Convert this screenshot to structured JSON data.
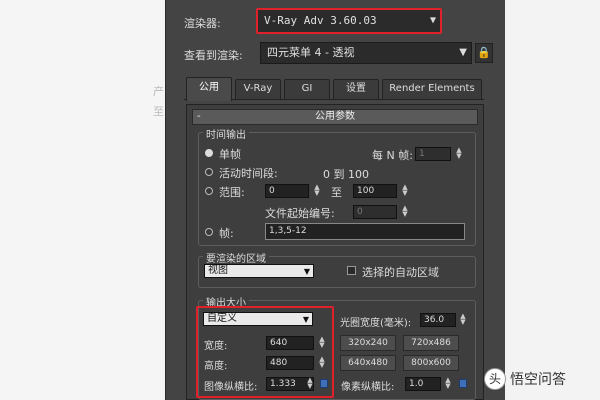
{
  "background": {
    "left_glyphs": [
      "产",
      "至"
    ]
  },
  "renderer": {
    "label": "渲染器:",
    "value": "V-Ray Adv 3.60.03"
  },
  "view": {
    "label": "查看到渲染:",
    "value": "四元菜单 4 - 透视"
  },
  "tabs": [
    "公用",
    "V-Ray",
    "GI",
    "设置",
    "Render Elements"
  ],
  "rollout_title": "公用参数",
  "time_output": {
    "title": "时间输出",
    "single": "单帧",
    "every_n_label": "每 N 帧:",
    "every_n_value": "1",
    "active_segment": "活动时间段:",
    "active_range": "0 到 100",
    "range_label": "范围:",
    "range_from": "0",
    "range_to_label": "至",
    "range_to": "100",
    "file_start_label": "文件起始编号:",
    "file_start_value": "0",
    "frames_label": "帧:",
    "frames_value": "1,3,5-12"
  },
  "area": {
    "title": "要渲染的区域",
    "value": "视图",
    "auto_region_label": "选择的自动区域"
  },
  "output_size": {
    "title": "输出大小",
    "preset": "自定义",
    "aperture_label": "光圈宽度(毫米):",
    "aperture_value": "36.0",
    "width_label": "宽度:",
    "width_value": "640",
    "height_label": "高度:",
    "height_value": "480",
    "presets": [
      "320x240",
      "720x486",
      "640x480",
      "800x600"
    ],
    "image_aspect_label": "图像纵横比:",
    "image_aspect_value": "1.333",
    "pixel_aspect_label": "像素纵横比:",
    "pixel_aspect_value": "1.0"
  },
  "watermark": {
    "icon": "头",
    "text": "悟空问答"
  },
  "colors": {
    "highlight": "#e0202a",
    "panel": "#444444"
  }
}
